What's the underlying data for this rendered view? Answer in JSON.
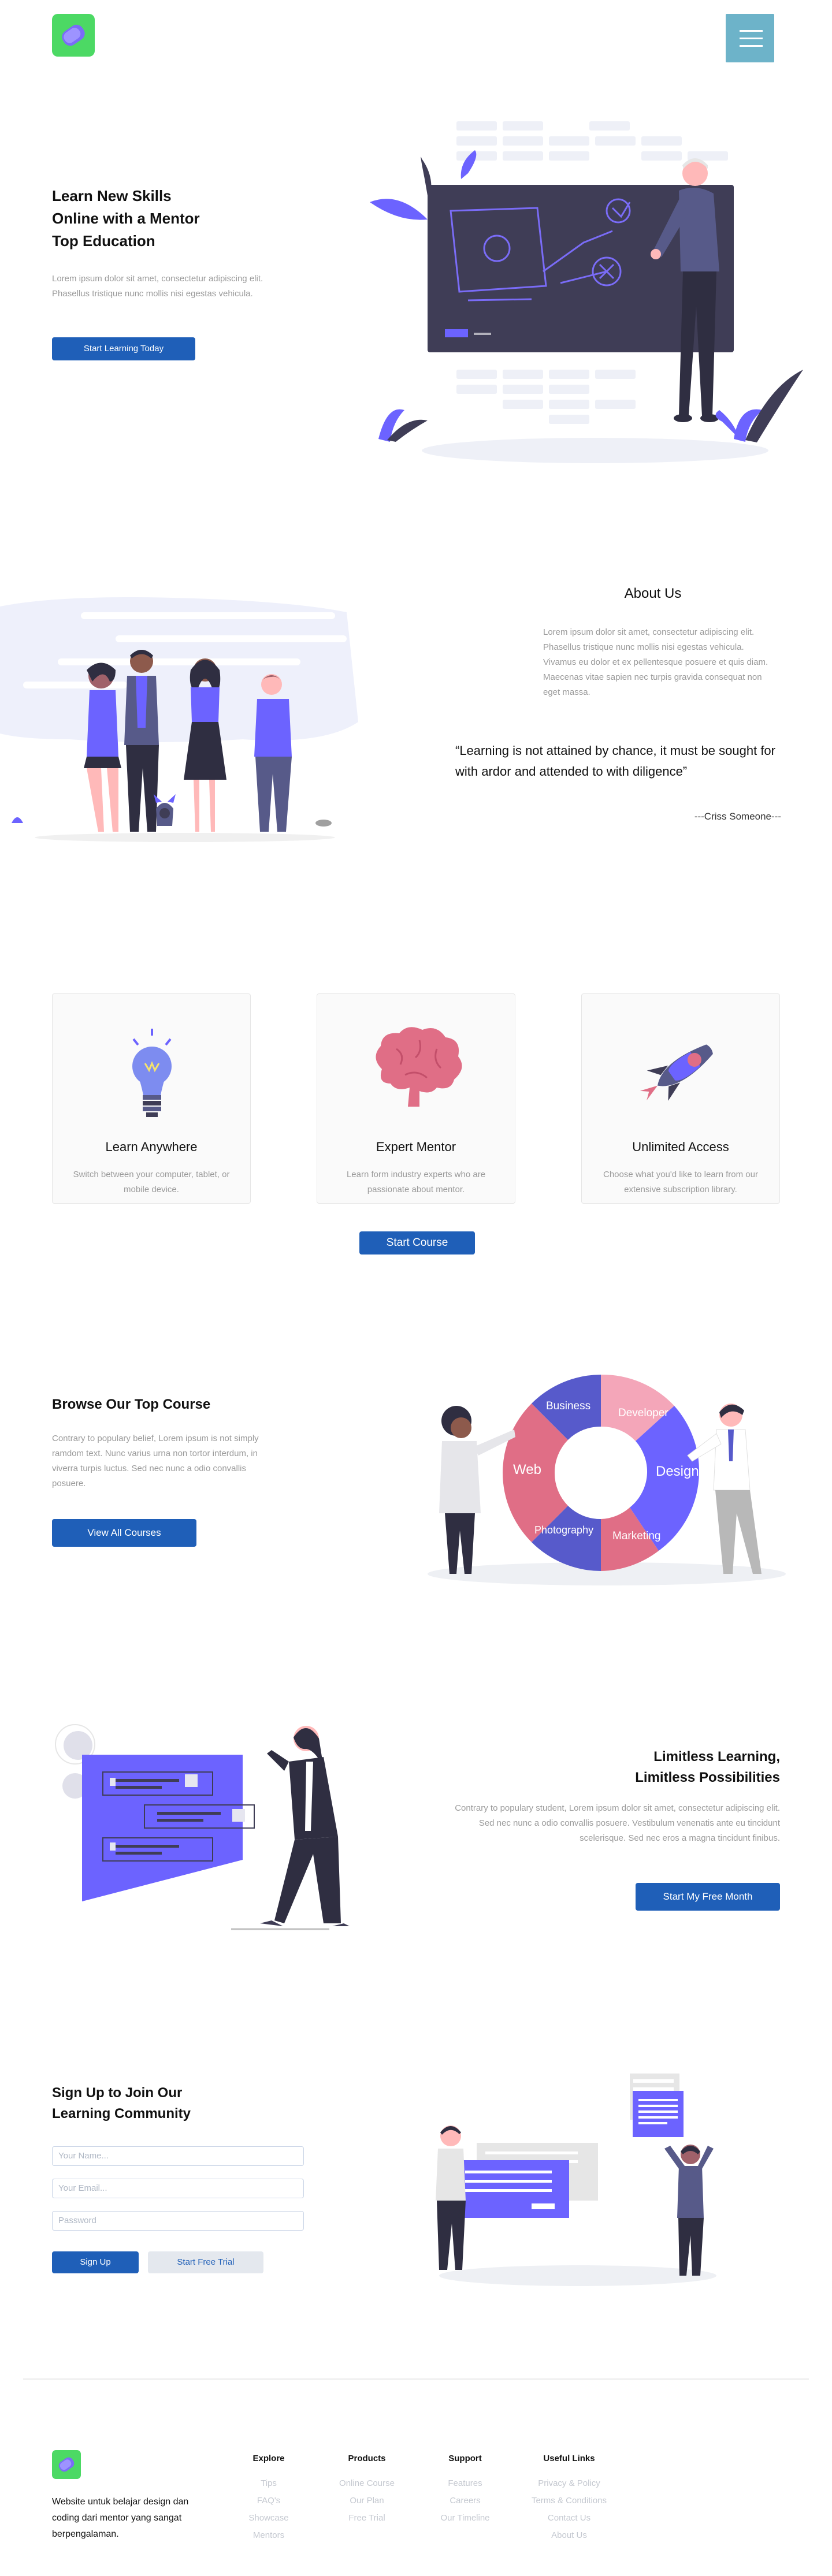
{
  "header": {
    "logo_icon": "brand-logo-icon",
    "menu_icon": "hamburger-menu-icon"
  },
  "hero": {
    "title_line1": "Learn New Skills",
    "title_line2": "Online with a Mentor",
    "title_line3": "Top Education",
    "text": "Lorem ipsum dolor sit amet, consectetur adipiscing elit. Phasellus tristique nunc mollis nisi egestas vehicula.",
    "cta": "Start Learning Today"
  },
  "about": {
    "title": "About Us",
    "text": "Lorem ipsum dolor sit amet, consectetur adipiscing elit. Phasellus tristique nunc mollis nisi egestas vehicula. Vivamus eu dolor et ex pellentesque posuere et quis diam. Maecenas vitae sapien nec turpis gravida consequat non eget massa.",
    "quote": "“Learning is not attained by chance, it must be sought for with ardor and attended to with diligence”",
    "author": "---Criss Someone---"
  },
  "features": {
    "cards": [
      {
        "icon": "lightbulb-icon",
        "title": "Learn Anywhere",
        "text": "Switch between your computer, tablet, or mobile device."
      },
      {
        "icon": "brain-icon",
        "title": "Expert Mentor",
        "text": "Learn form industry experts who are passionate about mentor."
      },
      {
        "icon": "rocket-icon",
        "title": "Unlimited Access",
        "text": "Choose what you'd like to learn from our extensive subscription library."
      }
    ],
    "cta": "Start Course"
  },
  "courses": {
    "title": "Browse Our Top Course",
    "text": "Contrary to populary belief, Lorem ipsum is not simply ramdom text. Nunc varius urna non tortor interdum, in viverra turpis luctus. Sed nec nunc a odio convallis posuere.",
    "cta": "View All Courses",
    "puzzle_labels": [
      "Business",
      "Developer",
      "Design",
      "Marketing",
      "Photography",
      "Web"
    ]
  },
  "limitless": {
    "title_line1": "Limitless Learning,",
    "title_line2": "Limitless Possibilities",
    "text": "Contrary to populary student, Lorem ipsum dolor sit amet, consectetur adipiscing elit. Sed nec nunc a odio convallis posuere. Vestibulum venenatis ante eu tincidunt scelerisque. Sed nec eros a magna tincidunt finibus.",
    "cta": "Start My Free Month"
  },
  "signup": {
    "title_line1": "Sign Up to Join Our",
    "title_line2": "Learning Community",
    "name_placeholder": "Your Name...",
    "email_placeholder": "Your Email...",
    "password_placeholder": "Password",
    "signup_button": "Sign Up",
    "trial_button": "Start Free Trial"
  },
  "footer": {
    "tagline": "Website untuk belajar design dan coding dari mentor yang sangat berpengalaman.",
    "columns": [
      {
        "title": "Explore",
        "links": [
          "Tips",
          "FAQ's",
          "Showcase",
          "Mentors"
        ]
      },
      {
        "title": "Products",
        "links": [
          "Online Course",
          "Our Plan",
          "Free Trial"
        ]
      },
      {
        "title": "Support",
        "links": [
          "Features",
          "Careers",
          "Our Timeline"
        ]
      },
      {
        "title": "Useful Links",
        "links": [
          "Privacy & Policy",
          "Terms & Conditions",
          "Contact Us",
          "About Us"
        ]
      }
    ]
  },
  "colors": {
    "primary": "#1f5fb8",
    "accent_purple": "#6c63ff",
    "menu_button": "#6db3c9",
    "logo_green": "#4cd964",
    "pink": "#e06e86"
  }
}
